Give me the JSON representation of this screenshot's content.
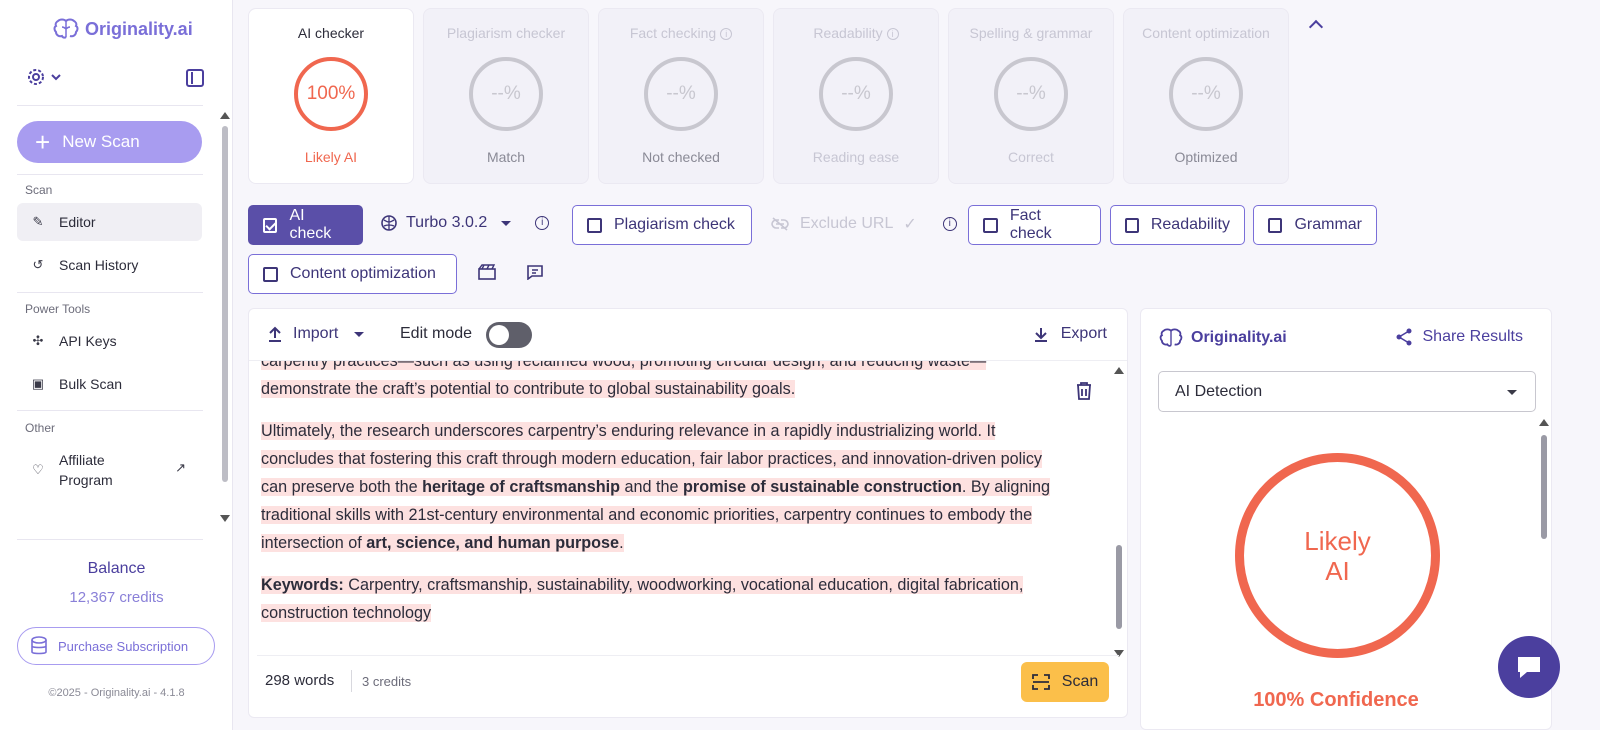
{
  "brand": {
    "name": "Originality.ai"
  },
  "sidebar": {
    "new_scan": "New Scan",
    "section_scan": "Scan",
    "editor": "Editor",
    "scan_history": "Scan History",
    "section_power": "Power Tools",
    "api_keys": "API Keys",
    "bulk_scan": "Bulk Scan",
    "section_other": "Other",
    "affiliate_line1": "Affiliate",
    "affiliate_line2": "Program",
    "balance_label": "Balance",
    "balance_value": "12,367 credits",
    "purchase": "Purchase Subscription",
    "copyright": "©2025 - Originality.ai - 4.1.8"
  },
  "cards": [
    {
      "title": "AI checker",
      "value": "100%",
      "sub": "Likely AI"
    },
    {
      "title": "Plagiarism checker",
      "value": "--%",
      "sub": "Match"
    },
    {
      "title": "Fact checking",
      "value": "--%",
      "sub": "Not checked"
    },
    {
      "title": "Readability",
      "value": "--%",
      "sub": "Reading ease"
    },
    {
      "title": "Spelling & grammar",
      "value": "--%",
      "sub": "Correct"
    },
    {
      "title": "Content optimization",
      "value": "--%",
      "sub": "Optimized"
    }
  ],
  "options": {
    "ai_check": "AI check",
    "model": "Turbo 3.0.2",
    "plagiarism": "Plagiarism check",
    "exclude_url": "Exclude URL",
    "fact_check": "Fact check",
    "readability": "Readability",
    "grammar": "Grammar",
    "content_opt": "Content optimization"
  },
  "editor": {
    "import": "Import",
    "edit_mode": "Edit mode",
    "export": "Export",
    "p0": "carpentry practices—such as using reclaimed wood, promoting circular design, and reducing waste—demonstrate the craft’s potential to contribute to global sustainability goals.",
    "p1a": "Ultimately, the research underscores carpentry’s enduring relevance in a rapidly industrializing world. It concludes that fostering this craft through modern education, fair labor practices, and innovation-driven policy can preserve both the ",
    "p1b": "heritage of craftsmanship",
    "p1c": " and the ",
    "p1d": "promise of sustainable construction",
    "p1e": ". By aligning traditional skills with 21st-century environmental and economic priorities, carpentry continues to embody the intersection of ",
    "p1f": "art, science, and human purpose",
    "p1g": ".",
    "p2a": "Keywords:",
    "p2b": " Carpentry, craftsmanship, sustainability, woodworking, vocational education, digital fabrication, construction technology",
    "words": "298 words",
    "credits": "3 credits",
    "scan": "Scan"
  },
  "results": {
    "share": "Share Results",
    "select": "AI Detection",
    "ring_line1": "Likely",
    "ring_line2": "AI",
    "confidence": "100% Confidence"
  },
  "colors": {
    "accent": "#5a4fa8",
    "ai": "#f0674f",
    "scan": "#fbbf4a"
  }
}
